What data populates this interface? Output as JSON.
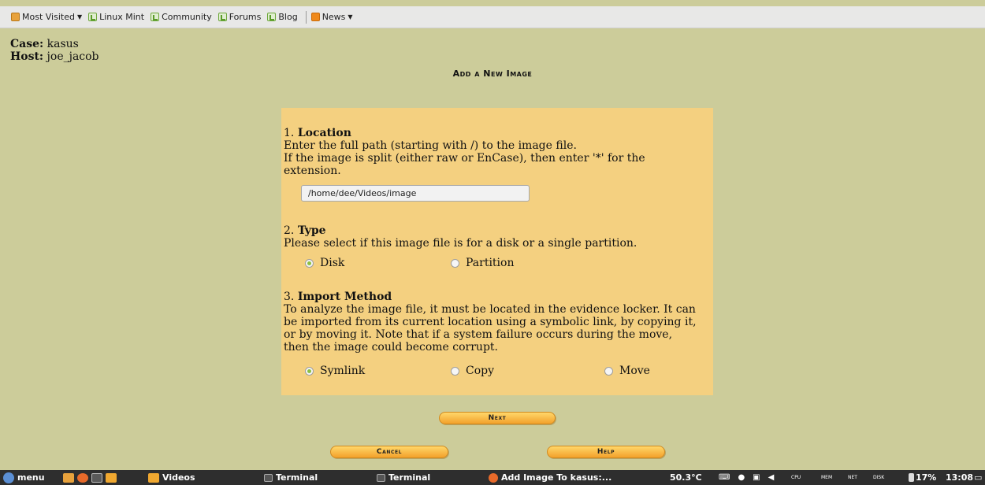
{
  "bookmarks": {
    "items": [
      {
        "label": "Most Visited",
        "dropdown": true,
        "icon": "folder-icon"
      },
      {
        "label": "Linux Mint",
        "icon": "mint-icon"
      },
      {
        "label": "Community",
        "icon": "mint-icon"
      },
      {
        "label": "Forums",
        "icon": "mint-icon"
      },
      {
        "label": "Blog",
        "icon": "mint-icon"
      }
    ],
    "news": "News"
  },
  "case": {
    "case_label": "Case:",
    "case_value": "kasus",
    "host_label": "Host:",
    "host_value": "joe_jacob"
  },
  "page_title": "Add a New Image",
  "location": {
    "num": "1.",
    "title": "Location",
    "line1": "Enter the full path (starting with /) to the image file.",
    "line2": "If the image is split (either raw or EnCase), then enter '*' for the",
    "line3": "extension.",
    "path_value": "/home/dee/Videos/image"
  },
  "type": {
    "num": "2.",
    "title": "Type",
    "desc": "Please select if this image file is for a disk or a single partition.",
    "options": [
      "Disk",
      "Partition"
    ],
    "selected": "Disk"
  },
  "import": {
    "num": "3.",
    "title": "Import Method",
    "lines": [
      "To analyze the image file, it must be located in the evidence locker. It can",
      "be imported from its current location using a symbolic link, by copying it,",
      "or by moving it. Note that if a system failure occurs during the move,",
      "then the image could become corrupt."
    ],
    "options": [
      "Symlink",
      "Copy",
      "Move"
    ],
    "selected": "Symlink"
  },
  "buttons": {
    "next": "Next",
    "cancel": "Cancel",
    "help": "Help"
  },
  "taskbar": {
    "menu": "menu",
    "videos": "Videos",
    "terminal1": "Terminal",
    "terminal2": "Terminal",
    "browser": "Add Image To kasus:...",
    "temp": "50.3°C",
    "cpu": "CPU",
    "mem": "MEM",
    "net": "NET",
    "disk": "DISK",
    "battery": "17%",
    "clock": "13:08"
  },
  "colors": {
    "background": "#cccc9a",
    "panel": "#f4d080",
    "button": "#f3a12b",
    "taskbar": "#2e2e2e"
  }
}
